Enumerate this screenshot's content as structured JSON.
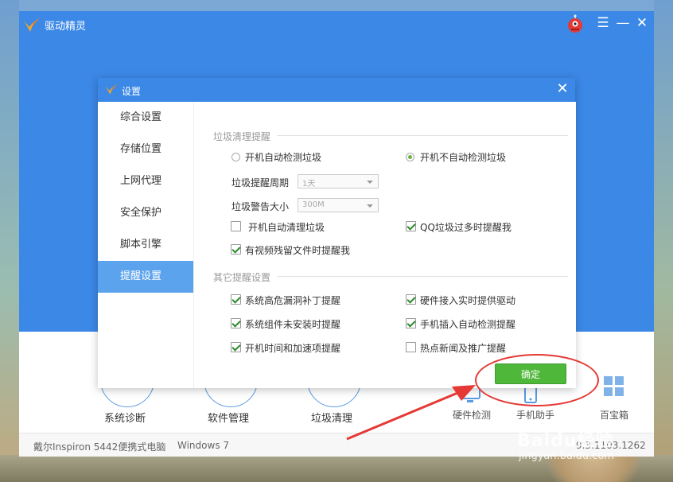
{
  "app": {
    "title": "驱动精灵",
    "brand_color": "#3b88e6"
  },
  "tiles": [
    {
      "label": "系统诊断"
    },
    {
      "label": "软件管理"
    },
    {
      "label": "垃圾清理"
    }
  ],
  "mini_tiles": [
    {
      "label": "硬件检测"
    },
    {
      "label": "手机助手"
    },
    {
      "label": "百宝箱"
    }
  ],
  "status": {
    "device": "戴尔Inspiron 5442便携式电脑",
    "os": "Windows 7",
    "version": "9.3.1103.1262"
  },
  "dialog": {
    "title": "设置",
    "nav": [
      {
        "label": "综合设置"
      },
      {
        "label": "存储位置"
      },
      {
        "label": "上网代理"
      },
      {
        "label": "安全保护"
      },
      {
        "label": "脚本引擎"
      },
      {
        "label": "提醒设置",
        "active": true
      }
    ],
    "junk_group": {
      "title": "垃圾清理提醒",
      "radio_auto": "开机自动检测垃圾",
      "radio_no_auto": "开机不自动检测垃圾",
      "cycle_label": "垃圾提醒周期",
      "cycle_value": "1天",
      "size_label": "垃圾警告大小",
      "size_value": "300M",
      "cb_auto_clean": "开机自动清理垃圾",
      "cb_qq_junk": "QQ垃圾过多时提醒我",
      "cb_video_residue": "有视频残留文件时提醒我"
    },
    "other_group": {
      "title": "其它提醒设置",
      "items": [
        {
          "label": "系统高危漏洞补丁提醒",
          "checked": true
        },
        {
          "label": "硬件接入实时提供驱动",
          "checked": true
        },
        {
          "label": "系统组件未安装时提醒",
          "checked": true
        },
        {
          "label": "手机插入自动检测提醒",
          "checked": true
        },
        {
          "label": "开机时间和加速项提醒",
          "checked": true
        },
        {
          "label": "热点新闻及推广提醒",
          "checked": false
        }
      ]
    },
    "ok_label": "确定"
  },
  "watermark": {
    "main": "Baidu经验",
    "sub": "jingyan.baidu.com"
  }
}
